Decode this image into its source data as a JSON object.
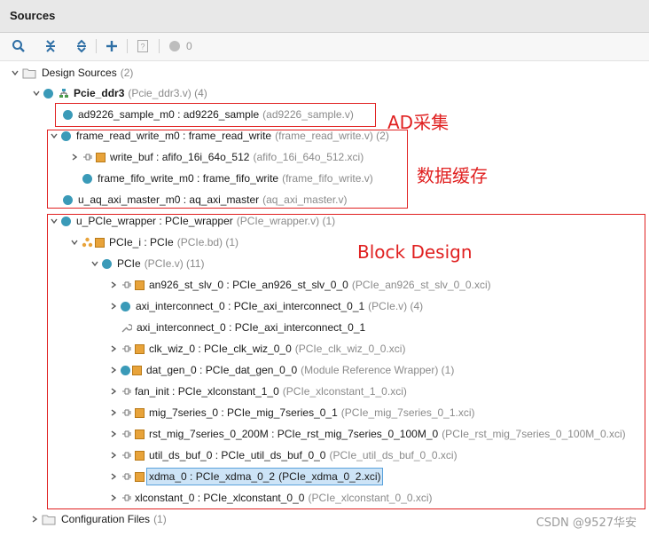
{
  "panel": {
    "title": "Sources"
  },
  "toolbar": {
    "search_icon": "search-icon",
    "collapse_icon": "collapse-all-icon",
    "expand_icon": "expand-all-icon",
    "add_icon": "plus-icon",
    "doc_icon": "question-doc-icon",
    "status_count": "0"
  },
  "tree": {
    "design_sources": {
      "label": "Design Sources",
      "count": "(2)"
    },
    "top": {
      "name": "Pcie_ddr3",
      "src": "(Pcie_ddr3.v) (4)"
    },
    "ad9226": {
      "name": "ad9226_sample_m0 : ad9226_sample",
      "src": "(ad9226_sample.v)"
    },
    "frw": {
      "name": "frame_read_write_m0 : frame_read_write",
      "src": "(frame_read_write.v) (2)"
    },
    "write_buf": {
      "name": "write_buf : afifo_16i_64o_512",
      "src": "(afifo_16i_64o_512.xci)"
    },
    "fifo_write": {
      "name": "frame_fifo_write_m0 : frame_fifo_write",
      "src": "(frame_fifo_write.v)"
    },
    "aq_axi": {
      "name": "u_aq_axi_master_m0 : aq_axi_master",
      "src": "(aq_axi_master.v)"
    },
    "wrapper": {
      "name": "u_PCIe_wrapper : PCIe_wrapper",
      "src": "(PCIe_wrapper.v) (1)"
    },
    "pcie_i": {
      "name": "PCIe_i : PCIe",
      "src": "(PCIe.bd) (1)"
    },
    "pcie": {
      "name": "PCIe",
      "src": "(PCIe.v) (11)"
    },
    "children": [
      {
        "name": "an926_st_slv_0 : PCIe_an926_st_slv_0_0",
        "src": "(PCIe_an926_st_slv_0_0.xci)"
      },
      {
        "name": "axi_interconnect_0 : PCIe_axi_interconnect_0_1",
        "src": "(PCIe.v) (4)"
      },
      {
        "name": "axi_interconnect_0 : PCIe_axi_interconnect_0_1",
        "src": ""
      },
      {
        "name": "clk_wiz_0 : PCIe_clk_wiz_0_0",
        "src": "(PCIe_clk_wiz_0_0.xci)"
      },
      {
        "name": "dat_gen_0 : PCIe_dat_gen_0_0",
        "src": "(Module Reference Wrapper) (1)"
      },
      {
        "name": "fan_init : PCIe_xlconstant_1_0",
        "src": "(PCIe_xlconstant_1_0.xci)"
      },
      {
        "name": "mig_7series_0 : PCIe_mig_7series_0_1",
        "src": "(PCIe_mig_7series_0_1.xci)"
      },
      {
        "name": "rst_mig_7series_0_200M : PCIe_rst_mig_7series_0_100M_0",
        "src": "(PCIe_rst_mig_7series_0_100M_0.xci)"
      },
      {
        "name": "util_ds_buf_0 : PCIe_util_ds_buf_0_0",
        "src": "(PCIe_util_ds_buf_0_0.xci)"
      },
      {
        "name": "xdma_0 : PCIe_xdma_0_2",
        "src": "(PCIe_xdma_0_2.xci)"
      },
      {
        "name": "xlconstant_0 : PCIe_xlconstant_0_0",
        "src": "(PCIe_xlconstant_0_0.xci)"
      }
    ],
    "config_files": {
      "label": "Configuration Files",
      "count": "(1)"
    }
  },
  "annotations": {
    "ad": "AD采集",
    "cache": "数据缓存",
    "block": "Block Design"
  },
  "watermark": "CSDN @9527华安",
  "colors": {
    "accent": "#3a9ab8",
    "ip_orange": "#e8a33a",
    "annotation_red": "#e02020",
    "selection": "#cde4f7"
  }
}
